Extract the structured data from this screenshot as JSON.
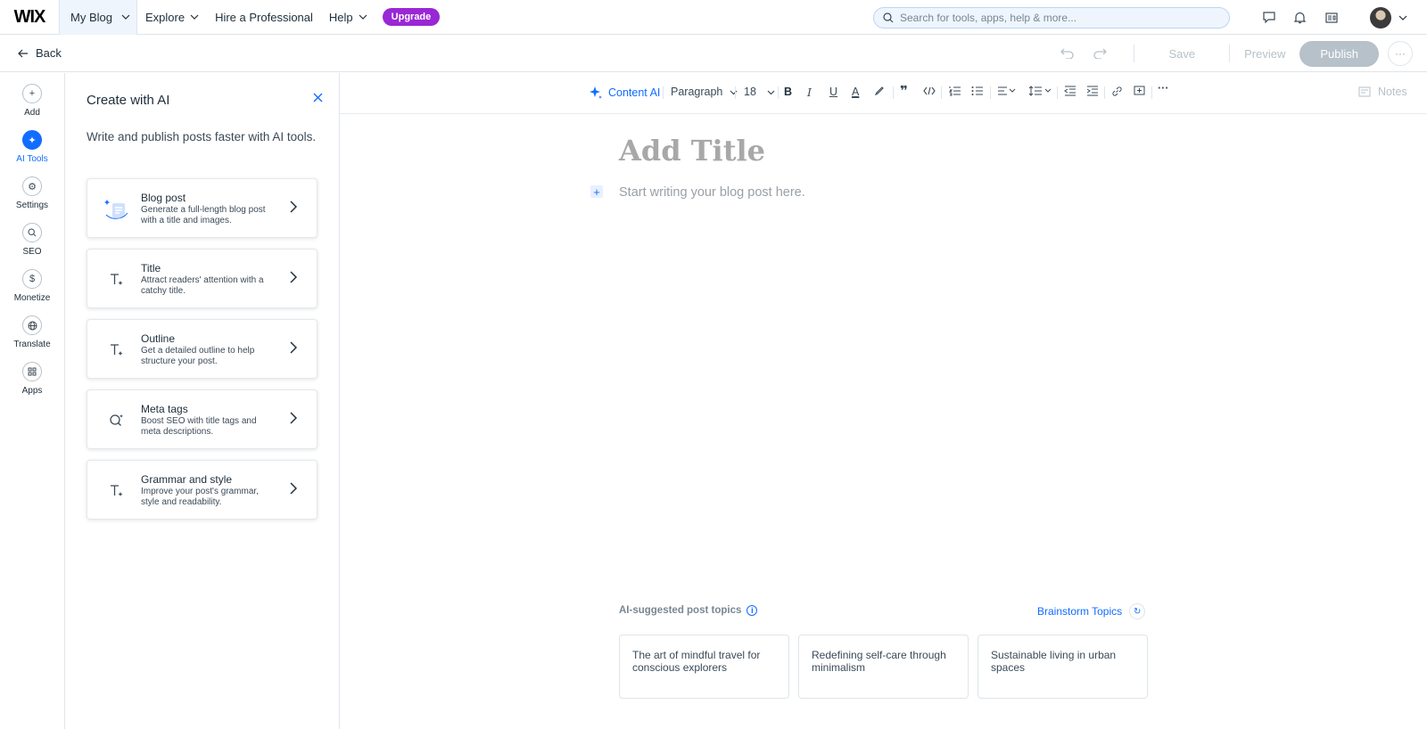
{
  "topbar": {
    "logo": "WIX",
    "site_name": "My Blog",
    "nav": [
      "Explore",
      "Hire a Professional",
      "Help"
    ],
    "upgrade_label": "Upgrade",
    "search_placeholder": "Search for tools, apps, help & more..."
  },
  "secondary_bar": {
    "back_label": "Back",
    "save_label": "Save",
    "preview_label": "Preview",
    "publish_label": "Publish"
  },
  "rail": {
    "items": [
      {
        "label": "Add",
        "icon": "plus-icon"
      },
      {
        "label": "AI Tools",
        "icon": "sparkle-icon",
        "active": true
      },
      {
        "label": "Settings",
        "icon": "gear-icon"
      },
      {
        "label": "SEO",
        "icon": "search-icon"
      },
      {
        "label": "Monetize",
        "icon": "dollar-icon"
      },
      {
        "label": "Translate",
        "icon": "globe-icon"
      },
      {
        "label": "Apps",
        "icon": "apps-icon"
      }
    ]
  },
  "ai_panel": {
    "title": "Create with AI",
    "subtitle": "Write and publish posts faster with AI tools.",
    "cards": [
      {
        "title": "Blog post",
        "desc": "Generate a full-length blog post with a title and images.",
        "icon": "blog-post-icon"
      },
      {
        "title": "Title",
        "desc": "Attract readers' attention with a catchy title.",
        "icon": "text-sparkle-icon"
      },
      {
        "title": "Outline",
        "desc": "Get a detailed outline to help structure your post.",
        "icon": "text-sparkle-icon"
      },
      {
        "title": "Meta tags",
        "desc": "Boost SEO with title tags and meta descriptions.",
        "icon": "search-sparkle-icon"
      },
      {
        "title": "Grammar and style",
        "desc": "Improve your post's grammar, style and readability.",
        "icon": "text-sparkle-icon"
      }
    ]
  },
  "toolbar": {
    "content_ai": "Content AI",
    "paragraph": "Paragraph",
    "font_size": "18",
    "notes": "Notes"
  },
  "editor": {
    "title_placeholder": "Add Title",
    "body_placeholder": "Start writing your blog post here."
  },
  "topics": {
    "label": "AI-suggested post topics",
    "brainstorm_label": "Brainstorm Topics",
    "items": [
      "The art of mindful travel for conscious explorers",
      "Redefining self-care through minimalism",
      "Sustainable living in urban spaces"
    ]
  },
  "colors": {
    "accent": "#116dff",
    "upgrade": "#9a27d5",
    "disabled": "#b6c1c9"
  }
}
